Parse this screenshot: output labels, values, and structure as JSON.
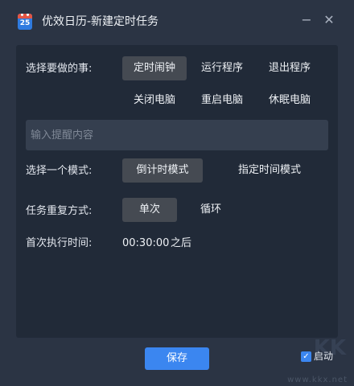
{
  "window": {
    "title": "优效日历-新建定时任务",
    "app_icon_number": "25",
    "minimize_glyph": "−",
    "close_glyph": "✕"
  },
  "task_row": {
    "label": "选择要做的事:",
    "options": [
      "定时闹钟",
      "运行程序",
      "退出程序",
      "关闭电脑",
      "重启电脑",
      "休眠电脑"
    ],
    "selected": "定时闹钟"
  },
  "reminder_input": {
    "value": "",
    "placeholder": "输入提醒内容"
  },
  "mode_row": {
    "label": "选择一个模式:",
    "options": [
      "倒计时模式",
      "指定时间模式"
    ],
    "selected": "倒计时模式"
  },
  "repeat_row": {
    "label": "任务重复方式:",
    "options": [
      "单次",
      "循环"
    ],
    "selected": "单次"
  },
  "first_run": {
    "label": "首次执行时间:",
    "time": "00:30:00",
    "suffix": "之后"
  },
  "footer": {
    "save_label": "保存",
    "autostart_label": "启动",
    "autostart_checked": true
  },
  "watermark": {
    "text": "www.kkx.net",
    "logo_text": "KK"
  },
  "colors": {
    "accent": "#3b86f0",
    "window_bg": "#2b3444",
    "panel_bg": "#212a38",
    "selected_option_bg": "#454a52"
  }
}
